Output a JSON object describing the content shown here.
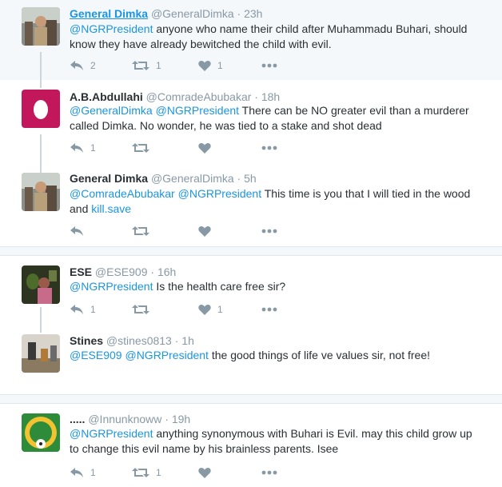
{
  "tweets": [
    {
      "name": "General Dimka",
      "handle": "@GeneralDimka",
      "time": "· 23h",
      "mention1": "@NGRPresident",
      "text_rest": " anyone who name their child after Muhammadu Buhari, should know they have already bewitched the child with evil.",
      "reply_count": "2",
      "retweet_count": "1",
      "like_count": "1"
    },
    {
      "name": "A.B.Abdullahi",
      "handle": "@ComradeAbubakar",
      "time": "· 18h",
      "mention1": "@GeneralDimka",
      "mention2": "@NGRPresident",
      "text_rest": " There can be NO greater evil than a murderer called Dimka. No wonder, he was tied to a stake and shot dead",
      "reply_count": "1"
    },
    {
      "name": "General Dimka",
      "handle": "@GeneralDimka",
      "time": "· 5h",
      "mention1": "@ComradeAbubakar",
      "mention2": "@NGRPresident",
      "text_rest": " This time is you that I will tied in the wood and ",
      "link": "kill.save"
    },
    {
      "name": "ESE",
      "handle": "@ESE909",
      "time": "· 16h",
      "mention1": "@NGRPresident",
      "text_rest": " Is the health care free sir?",
      "reply_count": "1",
      "like_count": "1"
    },
    {
      "name": "Stines",
      "handle": "@stines0813",
      "time": "· 1h",
      "mention1": "@ESE909",
      "mention2": "@NGRPresident",
      "text_rest": " the good things of life ve values sir, not free!"
    },
    {
      "name": ".....",
      "handle": "@Innunknoww",
      "time": "· 19h",
      "mention1": "@NGRPresident",
      "text_rest": " anything synonymous with Buhari is Evil. may this child grow up to change this evil name by his brainless parents. Isee",
      "reply_count": "1",
      "retweet_count": "1"
    }
  ],
  "colors": {
    "link": "#1b95e0",
    "muted": "#8899a6",
    "text": "#292f33",
    "like_heart": "#ccd6dd"
  },
  "icons": [
    "reply-icon",
    "retweet-icon",
    "like-icon",
    "more-icon"
  ]
}
